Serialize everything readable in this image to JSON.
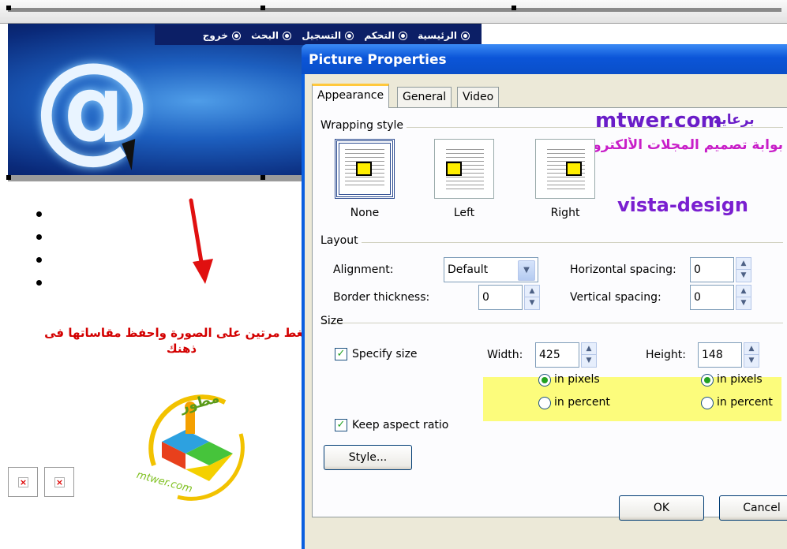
{
  "page": {
    "nav_items": [
      "الرئيسية",
      "التحكم",
      "التسجيل",
      "البحث",
      "خروج"
    ],
    "banner_symbol": "@",
    "note_arabic": "اضغط مرتين على الصورة واحفظ مقاساتها فى ذهنك",
    "logo": {
      "top_text": "مطور",
      "bottom_text": "mtwer.com"
    },
    "broken_image_glyph": "×"
  },
  "dialog": {
    "title": "Picture Properties",
    "tabs": [
      "Appearance",
      "General",
      "Video"
    ],
    "active_tab": "Appearance",
    "wrapping_style": {
      "label": "Wrapping style",
      "options": [
        "None",
        "Left",
        "Right"
      ],
      "selected": "None"
    },
    "layout": {
      "label": "Layout",
      "alignment_label": "Alignment:",
      "alignment_value": "Default",
      "border_label": "Border thickness:",
      "border_value": "0",
      "hspacing_label": "Horizontal spacing:",
      "hspacing_value": "0",
      "vspacing_label": "Vertical spacing:",
      "vspacing_value": "0"
    },
    "size": {
      "label": "Size",
      "specify_label": "Specify size",
      "width_label": "Width:",
      "width_value": "425",
      "height_label": "Height:",
      "height_value": "148",
      "in_pixels": "in pixels",
      "in_percent": "in percent",
      "keep_aspect": "Keep aspect ratio"
    },
    "style_button": "Style...",
    "ok": "OK",
    "cancel": "Cancel",
    "watermark": {
      "site": "mtwer.com",
      "arabic1": "برعاية",
      "arabic2": "بوابة تصميم المجلات الألكترونية",
      "vista": "vista-design"
    }
  },
  "colors": {
    "title_bar": "#0b55d8",
    "highlight": "#fcfc7c",
    "tab_accent": "#ffc83c",
    "note_red": "#d30000"
  }
}
